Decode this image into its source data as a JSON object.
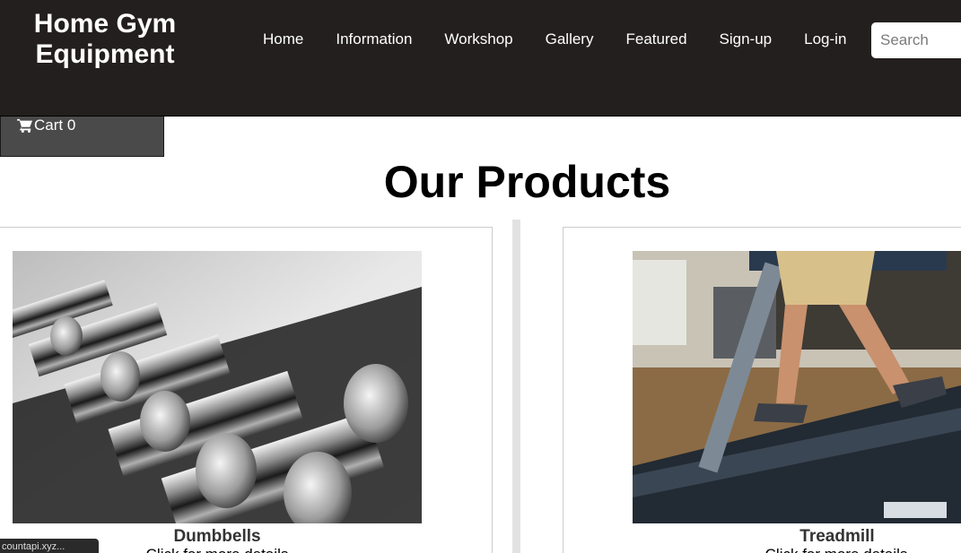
{
  "header": {
    "logo_line1": "Home Gym",
    "logo_line2": "Equipment",
    "nav": [
      "Home",
      "Information",
      "Workshop",
      "Gallery",
      "Featured",
      "Sign-up",
      "Log-in"
    ],
    "search_placeholder": "Search"
  },
  "cart": {
    "label": "Cart 0",
    "icon": "cart-icon"
  },
  "main": {
    "title": "Our Products"
  },
  "products": [
    {
      "name": "Dumbbells",
      "desc": "Click for more details",
      "image": "dumbbells-rack-photo"
    },
    {
      "name": "Treadmill",
      "desc": "Click for more details",
      "image": "person-running-treadmill-photo"
    }
  ],
  "badge": {
    "text": "countapi.xyz..."
  },
  "colors": {
    "header_bg": "#231f1e",
    "cart_bg": "#4a4a4a",
    "divider": "#e2e2e2"
  }
}
